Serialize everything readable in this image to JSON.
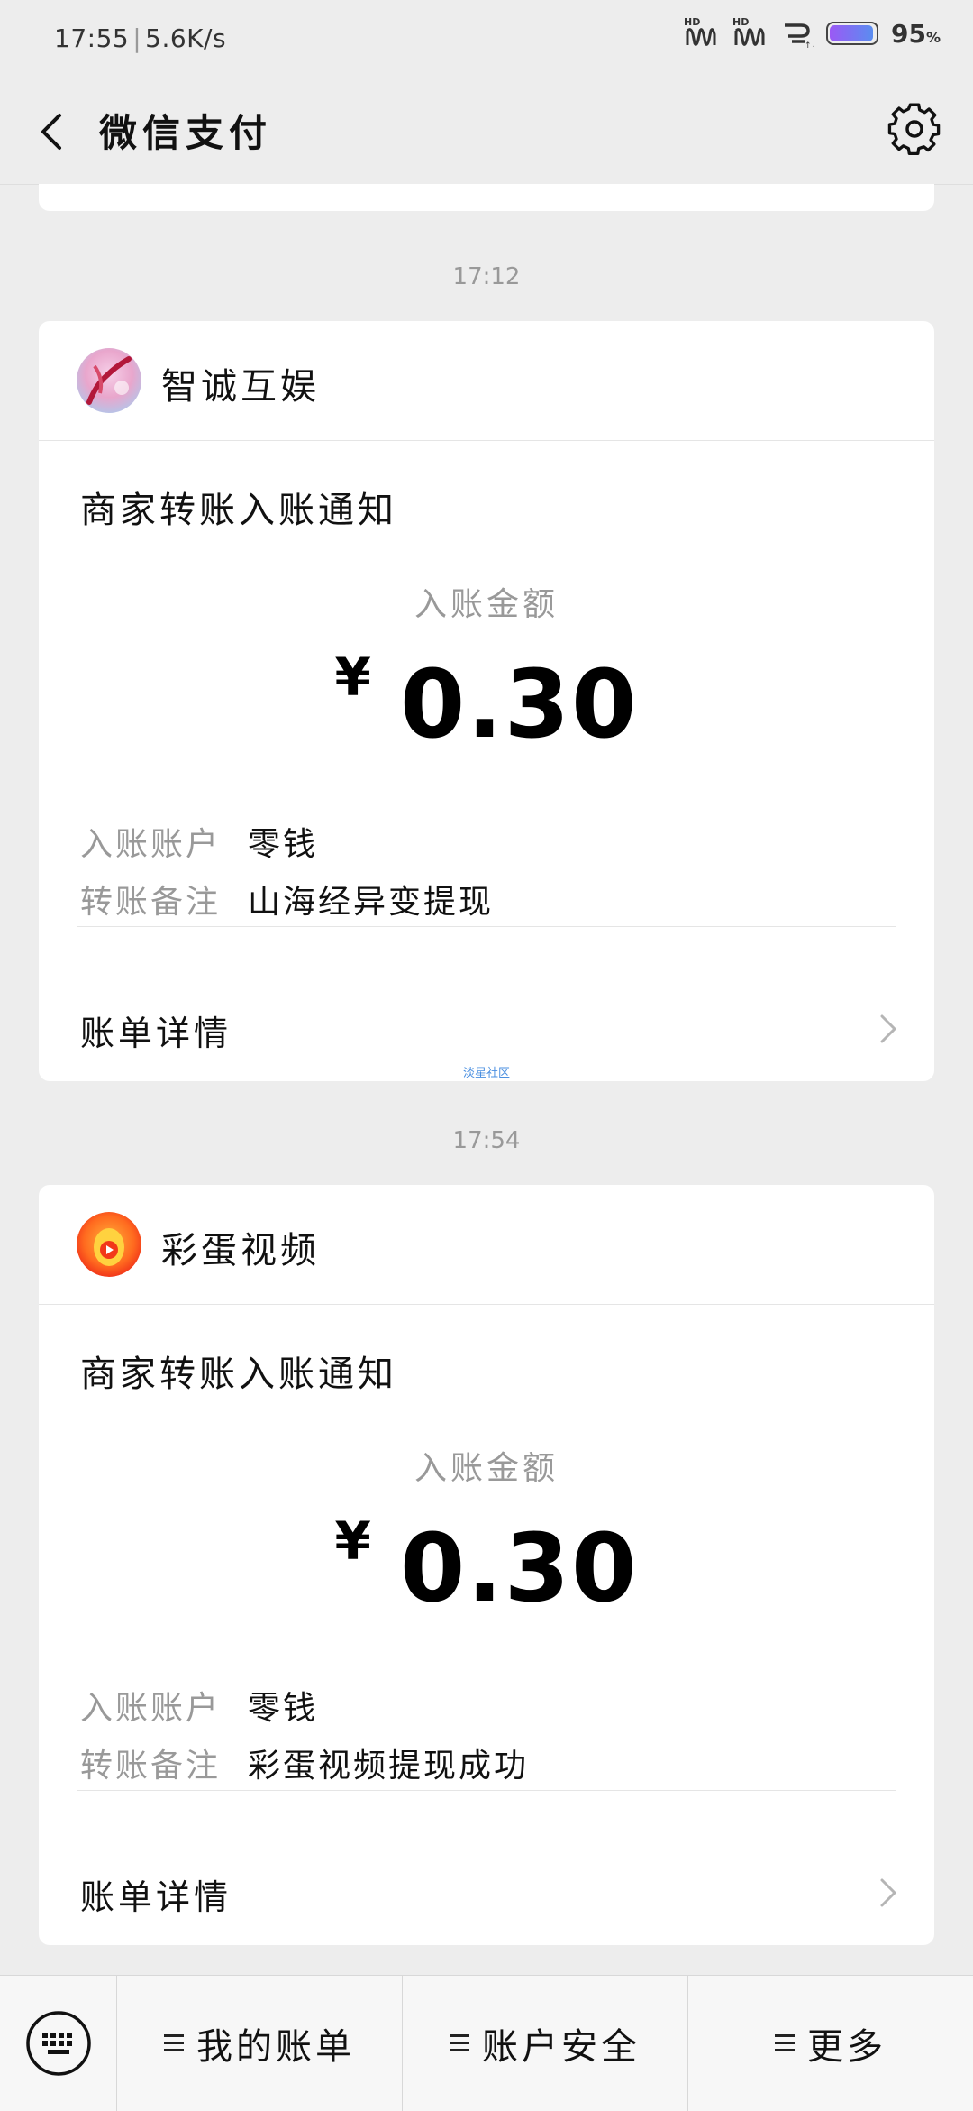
{
  "status_bar": {
    "time": "17:55",
    "net_speed": "5.6K/s",
    "signal1_label": "HD",
    "signal2_label": "HD",
    "battery_percent": "95",
    "battery_unit": "%",
    "battery_level": 0.95
  },
  "header": {
    "title": "微信支付",
    "back_icon": "chevron-left-icon",
    "settings_icon": "gear-icon"
  },
  "messages": [
    {
      "time": "17:12",
      "merchant": "智诚互娱",
      "notice_title": "商家转账入账通知",
      "amount_label": "入账金额",
      "currency": "¥",
      "amount": "0.30",
      "account_key": "入账账户",
      "account_value": "零钱",
      "remark_key": "转账备注",
      "remark_value": "山海经异变提现",
      "bill_detail": "账单详情",
      "watermark": "淡星社区"
    },
    {
      "time": "17:54",
      "merchant": "彩蛋视频",
      "notice_title": "商家转账入账通知",
      "amount_label": "入账金额",
      "currency": "¥",
      "amount": "0.30",
      "account_key": "入账账户",
      "account_value": "零钱",
      "remark_key": "转账备注",
      "remark_value": "彩蛋视频提现成功",
      "bill_detail": "账单详情"
    }
  ],
  "bottom_menu": {
    "keyboard_icon": "keyboard-icon",
    "items": [
      "我的账单",
      "账户安全",
      "更多"
    ]
  },
  "colors": {
    "background": "#ededed",
    "card": "#ffffff",
    "muted_text": "#999999",
    "watermark": "#4a8fe0"
  }
}
